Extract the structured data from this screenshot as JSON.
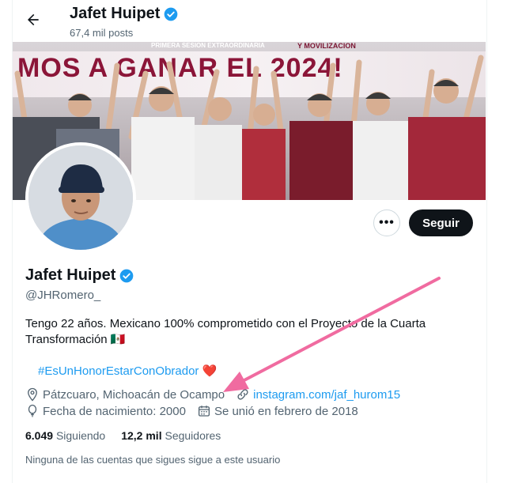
{
  "header": {
    "name": "Jafet Huipet",
    "posts": "67,4 mil posts"
  },
  "banner": {
    "slogan": "MOS A GANAR EL 2024!",
    "tag_left": "PRIMERA SESION EXTRAORDINARIA",
    "tag_right": "Y MOVILIZACION"
  },
  "actions": {
    "more_label": "•••",
    "follow_label": "Seguir"
  },
  "profile": {
    "name": "Jafet Huipet",
    "handle": "@JHRomero_",
    "bio_line1": "Tengo 22 años. Mexicano 100% comprometido con el Proyecto de la Cuarta",
    "bio_line2": "Transformación 🇲🇽",
    "hashtag": "#EsUnHonorEstarConObrador",
    "heart": "❤️",
    "location": "Pátzcuaro, Michoacán de Ocampo",
    "website": "instagram.com/jaf_hurom15",
    "birthday": "Fecha de nacimiento: 2000",
    "joined": "Se unió en febrero de 2018"
  },
  "stats": {
    "following_count": "6.049",
    "following_label": "Siguiendo",
    "followers_count": "12,2 mil",
    "followers_label": "Seguidores"
  },
  "followers_note": "Ninguna de las cuentas que sigues sigue a este usuario",
  "colors": {
    "accent": "#1d9bf0",
    "arrow": "#f06ba0",
    "text": "#0f1419",
    "muted": "#536471"
  },
  "icons": [
    "back-arrow-icon",
    "verified-badge-icon",
    "more-icon",
    "location-icon",
    "link-icon",
    "balloon-icon",
    "calendar-icon",
    "heart-icon"
  ]
}
